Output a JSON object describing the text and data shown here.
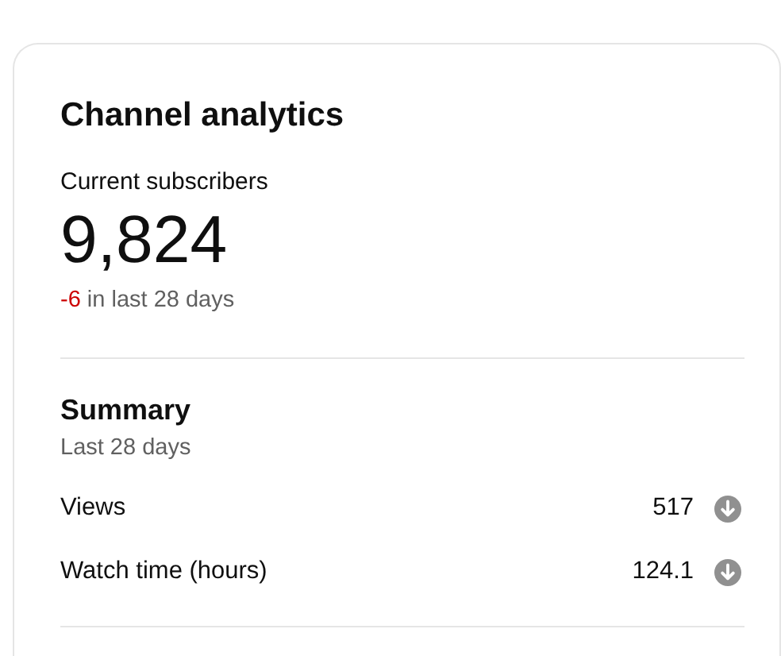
{
  "card": {
    "title": "Channel analytics",
    "subscribers": {
      "label": "Current subscribers",
      "value": "9,824",
      "change": {
        "value": "-6",
        "negative": true,
        "text": "in last 28 days"
      }
    },
    "summary": {
      "title": "Summary",
      "period": "Last 28 days",
      "metrics": [
        {
          "label": "Views",
          "value": "517",
          "decreased": true
        },
        {
          "label": "Watch time (hours)",
          "value": "124.1",
          "decreased": true
        }
      ]
    }
  }
}
